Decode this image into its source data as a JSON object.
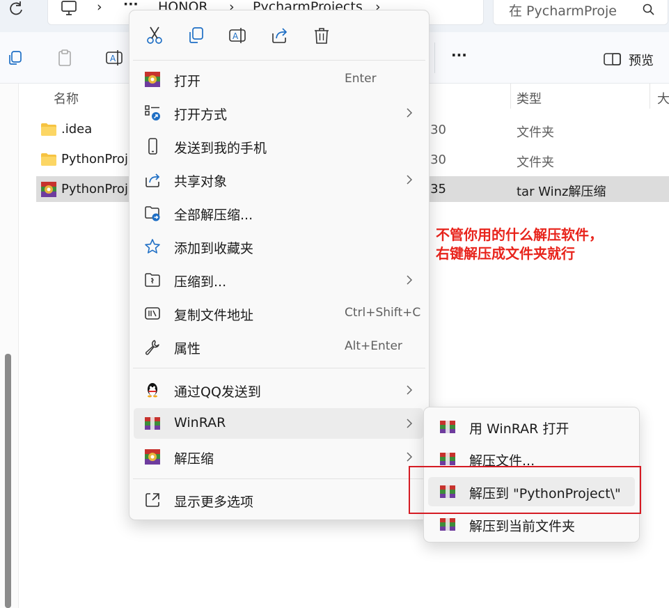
{
  "explorer": {
    "breadcrumb": [
      "HONOR",
      "PycharmProjects"
    ],
    "breadcrumb_more": "···",
    "search_placeholder": "在 PycharmProje",
    "toolbar_more": "···",
    "preview_label": "预览",
    "columns": {
      "name": "名称",
      "type": "类型",
      "size": "大"
    },
    "files": [
      {
        "name": ".idea",
        "time": ":30",
        "type": "文件夹",
        "icon": "folder-icon"
      },
      {
        "name": "PythonProj",
        "time": ":30",
        "type": "文件夹",
        "icon": "folder-icon"
      },
      {
        "name": "PythonProj",
        "time": ":35",
        "type": "tar Winz解压缩",
        "icon": "winrar-archive-icon",
        "selected": true
      }
    ]
  },
  "annotation": {
    "line1": "不管你用的什么解压软件，",
    "line2": "右键解压成文件夹就行",
    "color": "#e8241c"
  },
  "context_menu": {
    "quick_actions": [
      "cut-icon",
      "copy-icon",
      "rename-icon",
      "share-icon",
      "delete-icon"
    ],
    "items": [
      {
        "label": "打开",
        "shortcut": "Enter",
        "icon": "winrar-icon"
      },
      {
        "label": "打开方式",
        "submenu": true,
        "icon": "open-with-icon"
      },
      {
        "label": "发送到我的手机",
        "icon": "phone-icon"
      },
      {
        "label": "共享对象",
        "submenu": true,
        "icon": "share-icon"
      },
      {
        "label": "全部解压缩...",
        "icon": "extract-all-icon"
      },
      {
        "label": "添加到收藏夹",
        "icon": "star-icon"
      },
      {
        "label": "压缩到...",
        "submenu": true,
        "icon": "compress-icon"
      },
      {
        "label": "复制文件地址",
        "shortcut": "Ctrl+Shift+C",
        "icon": "copy-path-icon"
      },
      {
        "label": "属性",
        "shortcut": "Alt+Enter",
        "icon": "wrench-icon"
      },
      {
        "label": "通过QQ发送到",
        "submenu": true,
        "icon": "qq-icon"
      },
      {
        "label": "WinRAR",
        "submenu": true,
        "icon": "winrar-icon",
        "highlighted": true
      },
      {
        "label": "解压缩",
        "submenu": true,
        "icon": "winrar-icon"
      },
      {
        "label": "显示更多选项",
        "icon": "more-options-icon"
      }
    ]
  },
  "winrar_submenu": {
    "items": [
      {
        "label": "用 WinRAR 打开"
      },
      {
        "label": "解压文件..."
      },
      {
        "label": "解压到 \"PythonProject\\\"",
        "highlighted": true,
        "boxed": true
      },
      {
        "label": "解压到当前文件夹"
      }
    ],
    "highlight_color": "#d51b23"
  }
}
